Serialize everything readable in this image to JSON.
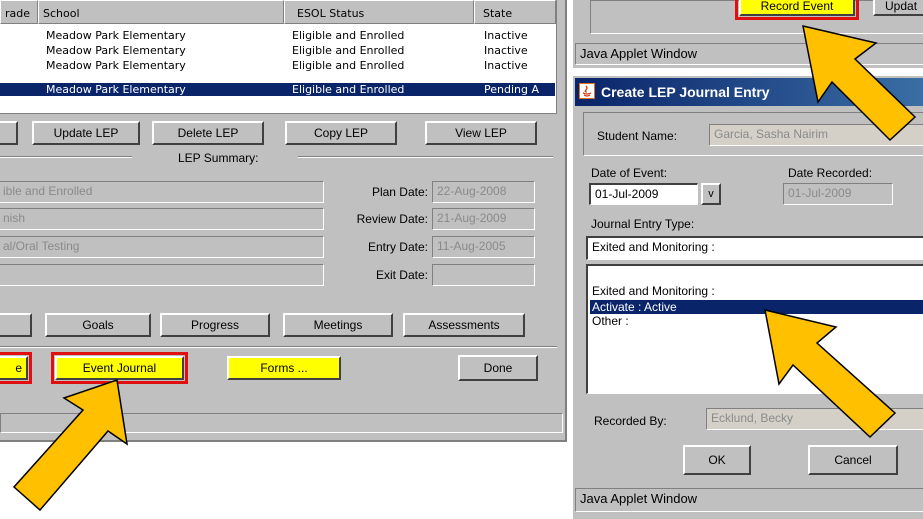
{
  "left": {
    "table": {
      "headers": [
        "rade",
        "School",
        "ESOL Status",
        "State"
      ],
      "rows": [
        {
          "school": "Meadow Park Elementary",
          "status": "Eligible and Enrolled",
          "state": "Inactive",
          "selected": false
        },
        {
          "school": "Meadow Park Elementary",
          "status": "Eligible and Enrolled",
          "state": "Inactive",
          "selected": false
        },
        {
          "school": "Meadow Park Elementary",
          "status": "Eligible and Enrolled",
          "state": "Inactive",
          "selected": false
        },
        {
          "school": "Meadow Park Elementary",
          "status": "Eligible and Enrolled",
          "state": "Pending A",
          "selected": true
        }
      ]
    },
    "buttons": {
      "update_lep": "Update LEP",
      "delete_lep": "Delete LEP",
      "copy_lep": "Copy LEP",
      "view_lep": "View LEP"
    },
    "summary_label": "LEP Summary:",
    "summary_fields": {
      "eligibility": "ible and Enrolled",
      "language": "nish",
      "testing": "al/Oral Testing",
      "blank": ""
    },
    "dates": {
      "plan_label": "Plan Date:",
      "plan_value": "22-Aug-2008",
      "review_label": "Review Date:",
      "review_value": "21-Aug-2009",
      "entry_label": "Entry Date:",
      "entry_value": "11-Aug-2005",
      "exit_label": "Exit Date:",
      "exit_value": ""
    },
    "tabs": {
      "goals": "Goals",
      "progress": "Progress",
      "meetings": "Meetings",
      "assessments": "Assessments"
    },
    "bottom": {
      "partial_button": "e",
      "event_journal": "Event Journal",
      "forms": "Forms ...",
      "done": "Done"
    }
  },
  "right_top": {
    "record_event": "Record Event",
    "update_partial": "Updat",
    "status": "Java Applet Window"
  },
  "dialog": {
    "title": "Create LEP Journal Entry",
    "student_label": "Student Name:",
    "student_value": "Garcia, Sasha Nairim",
    "date_event_label": "Date of Event:",
    "date_event_value": "01-Jul-2009",
    "date_dropdown": "v",
    "date_recorded_label": "Date Recorded:",
    "date_recorded_value": "01-Jul-2009",
    "entry_type_label": "Journal Entry Type:",
    "entry_type_value": "Exited and Monitoring :",
    "list_items": [
      {
        "label": "Exited and Monitoring :",
        "selected": false
      },
      {
        "label": "Activate : Active",
        "selected": true
      },
      {
        "label": "Other :",
        "selected": false
      }
    ],
    "recorded_by_label": "Recorded By:",
    "recorded_by_value": "Ecklund, Becky",
    "ok": "OK",
    "cancel": "Cancel",
    "status": "Java Applet Window"
  },
  "colors": {
    "panel": "#c0c0c0",
    "highlight": "#ffff00",
    "callout_border": "#e01010",
    "selection": "#0a246a",
    "arrow": "#ffc000"
  }
}
